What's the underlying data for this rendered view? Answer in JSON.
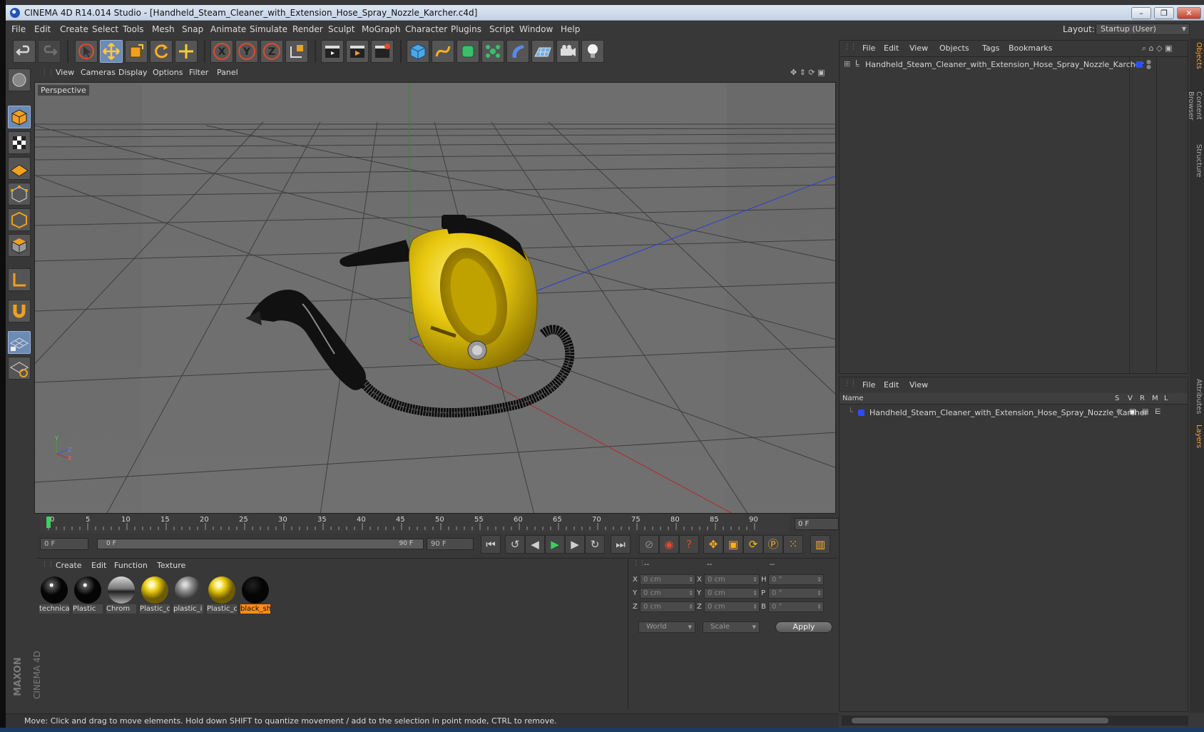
{
  "window": {
    "title": "CINEMA 4D R14.014 Studio - [Handheld_Steam_Cleaner_with_Extension_Hose_Spray_Nozzle_Karcher.c4d]",
    "minimize": "–",
    "restore": "❐",
    "close": "✕"
  },
  "menubar": {
    "items": [
      "File",
      "Edit",
      "Create",
      "Select",
      "Tools",
      "Mesh",
      "Snap",
      "Animate",
      "Simulate",
      "Render",
      "Sculpt",
      "MoGraph",
      "Character",
      "Plugins",
      "Script",
      "Window",
      "Help"
    ],
    "layout_label": "Layout:",
    "layout_value": "Startup (User)"
  },
  "viewport": {
    "menu": [
      "View",
      "Cameras",
      "Display",
      "Options",
      "Filter",
      "Panel"
    ],
    "label": "Perspective",
    "axis_y": "Y",
    "axis_z": "Z",
    "axis_x": "X"
  },
  "timeline": {
    "ticks": [
      "0",
      "5",
      "10",
      "15",
      "20",
      "25",
      "30",
      "35",
      "40",
      "45",
      "50",
      "55",
      "60",
      "65",
      "70",
      "75",
      "80",
      "85",
      "90"
    ],
    "current_frame": "0 F",
    "start_frame": "0 F",
    "range_start": "0 F",
    "range_end": "90 F",
    "end_frame": "90 F"
  },
  "materials": {
    "menu": [
      "Create",
      "Edit",
      "Function",
      "Texture"
    ],
    "items": [
      {
        "label": "technica",
        "color": "black"
      },
      {
        "label": "Plastic",
        "color": "black"
      },
      {
        "label": "Chrom",
        "color": "chrome"
      },
      {
        "label": "Plastic_c",
        "color": "yellow"
      },
      {
        "label": "plastic_i",
        "color": "grey"
      },
      {
        "label": "Plastic_c",
        "color": "yellow"
      },
      {
        "label": "black_sh",
        "color": "black"
      }
    ]
  },
  "coords": {
    "col_headers": [
      "--",
      "--",
      "--"
    ],
    "rows": [
      {
        "a": "X",
        "av": "0 cm",
        "b": "X",
        "bv": "0 cm",
        "c": "H",
        "cv": "0 °"
      },
      {
        "a": "Y",
        "av": "0 cm",
        "b": "Y",
        "bv": "0 cm",
        "c": "P",
        "cv": "0 °"
      },
      {
        "a": "Z",
        "av": "0 cm",
        "b": "Z",
        "bv": "0 cm",
        "c": "B",
        "cv": "0 °"
      }
    ],
    "world": "World",
    "scale": "Scale",
    "apply": "Apply"
  },
  "objects": {
    "menu": [
      "File",
      "Edit",
      "View",
      "Objects",
      "Tags",
      "Bookmarks"
    ],
    "item": "Handheld_Steam_Cleaner_with_Extension_Hose_Spray_Nozzle_Karcher"
  },
  "layers": {
    "menu": [
      "File",
      "Edit",
      "View"
    ],
    "col_name": "Name",
    "cols": [
      "S",
      "V",
      "R",
      "M",
      "L"
    ],
    "item": "Handheld_Steam_Cleaner_with_Extension_Hose_Spray_Nozzle_Karcher"
  },
  "sidetabs": [
    "Objects",
    "Content Browser",
    "Structure",
    "Attributes",
    "Layers"
  ],
  "status": "Move: Click and drag to move elements. Hold down SHIFT to quantize movement / add to the selection in point mode, CTRL to remove.",
  "brand": {
    "maxon": "MAXON",
    "c4d": "CINEMA 4D"
  }
}
